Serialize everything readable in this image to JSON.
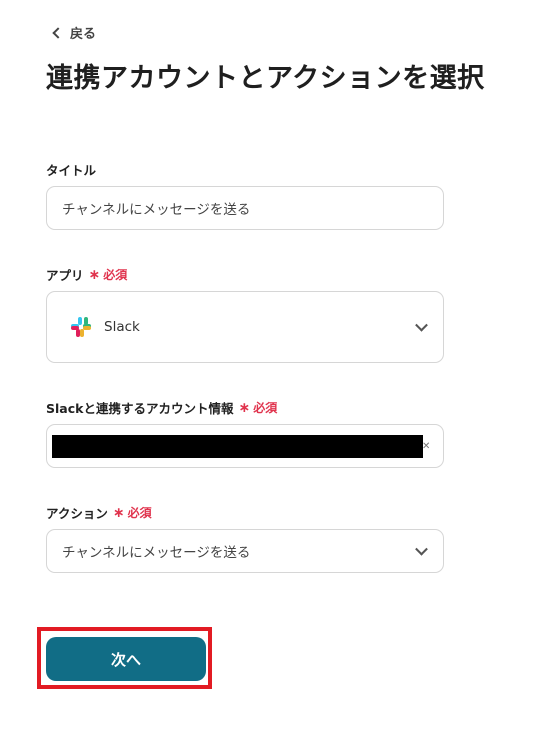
{
  "nav": {
    "back_label": "戻る"
  },
  "page": {
    "title": "連携アカウントとアクションを選択"
  },
  "title_field": {
    "label": "タイトル",
    "value": "チャンネルにメッセージを送る"
  },
  "app_field": {
    "label": "アプリ",
    "required": "必須",
    "value": "Slack",
    "icon": "slack-logo-icon"
  },
  "account_field": {
    "label": "Slackと連携するアカウント情報",
    "required": "必須"
  },
  "action_field": {
    "label": "アクション",
    "required": "必須",
    "value": "チャンネルにメッセージを送る"
  },
  "footer": {
    "next_label": "次へ"
  },
  "colors": {
    "primary_button": "#116d86",
    "required_mark": "#e0334d",
    "highlight_border": "#e21b23",
    "redaction": "#000000"
  }
}
